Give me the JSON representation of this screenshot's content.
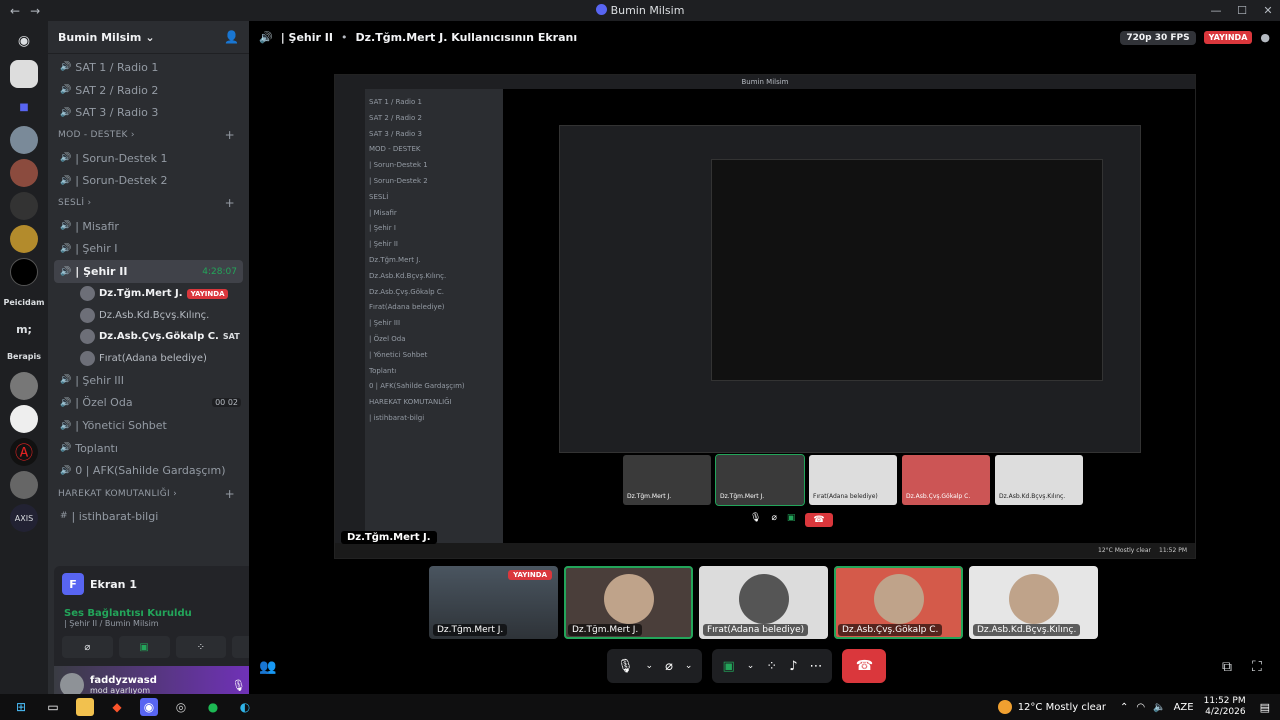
{
  "window": {
    "title": "Bumin Milsim",
    "controls": [
      "—",
      "☐",
      "✕"
    ]
  },
  "sidebar": {
    "server_name": "Bumin Milsim",
    "guild_labels": [
      "Peicidam",
      "m;",
      "Berapis"
    ],
    "channels": [
      {
        "type": "voice",
        "name": "SAT 1 / Radio 1"
      },
      {
        "type": "voice",
        "name": "SAT 2 / Radio 2"
      },
      {
        "type": "voice",
        "name": "SAT 3 / Radio 3"
      }
    ],
    "cat_mod": "MOD - DESTEK",
    "mod_channels": [
      "| Sorun-Destek 1",
      "| Sorun-Destek 2"
    ],
    "cat_sesli": "SESLİ",
    "sesli_channels": [
      "| Misafir",
      "| Şehir I"
    ],
    "active_channel": "| Şehir II",
    "active_time": "4:28:07",
    "members": [
      {
        "name": "Dz.Tğm.Mert J.",
        "badge": "YAYINDA",
        "bold": true
      },
      {
        "name": "Dz.Asb.Kd.Bçvş.Kılınç.",
        "badge": "",
        "bold": false
      },
      {
        "name": "Dz.Asb.Çvş.Gökalp C.",
        "badge": "SAT",
        "bold": true
      },
      {
        "name": "Fırat(Adana belediye)",
        "badge": "",
        "bold": false
      }
    ],
    "after_channels": [
      {
        "name": "| Şehir III",
        "pill": ""
      },
      {
        "name": "| Özel Oda",
        "pill": "00 02"
      },
      {
        "name": "| Yönetici Sohbet",
        "pill": ""
      },
      {
        "name": "Toplantı",
        "pill": ""
      },
      {
        "name": "0 | AFK(Sahilde Gardaşçım)",
        "pill": ""
      }
    ],
    "cat_harekat": "HAREKAT KOMUTANLIĞI",
    "harekat_channels": [
      "| istihbarat-bilgi"
    ]
  },
  "voice_panel": {
    "screen_label": "Ekran 1",
    "conn_title": "Ses Bağlantısı Kuruldu",
    "conn_sub": "| Şehir II / Bumin Milsim",
    "user_name": "faddyzwasd",
    "user_status": "mod ayarlıyom"
  },
  "stage": {
    "channel": "| Şehir II",
    "stream_title": "Dz.Tğm.Mert J. Kullanıcısının Ekranı",
    "quality": "720p 30 FPS",
    "live": "YAYINDA",
    "stream_label": "Dz.Tğm.Mert J."
  },
  "nested": {
    "channels": [
      "SAT 1 / Radio 1",
      "SAT 2 / Radio 2",
      "SAT 3 / Radio 3",
      "MOD - DESTEK",
      "| Sorun-Destek 1",
      "| Sorun-Destek 2",
      "SESLİ",
      "| Misafir",
      "| Şehir I",
      "| Şehir II",
      "Dz.Tğm.Mert J.",
      "Dz.Asb.Kd.Bçvş.Kılınç.",
      "Dz.Asb.Çvş.Gökalp C.",
      "Fırat(Adana belediye)",
      "| Şehir III",
      "| Özel Oda",
      "| Yönetici Sohbet",
      "Toplantı",
      "0 | AFK(Sahilde Gardaşçım)",
      "HAREKAT KOMUTANLIĞI",
      "| istihbarat-bilgi"
    ],
    "tiles": [
      "Dz.Tğm.Mert J.",
      "Dz.Tğm.Mert J.",
      "Fırat(Adana belediye)",
      "Dz.Asb.Çvş.Gökalp C.",
      "Dz.Asb.Kd.Bçvş.Kılınç."
    ],
    "weather": "12°C Mostly clear",
    "time": "11:52 PM"
  },
  "tiles": [
    {
      "label": "Dz.Tğm.Mert J.",
      "live": "YAYINDA"
    },
    {
      "label": "Dz.Tğm.Mert J.",
      "live": ""
    },
    {
      "label": "Fırat(Adana belediye)",
      "live": ""
    },
    {
      "label": "Dz.Asb.Çvş.Gökalp C.",
      "live": ""
    },
    {
      "label": "Dz.Asb.Kd.Bçvş.Kılınç.",
      "live": ""
    }
  ],
  "taskbar": {
    "weather": "12°C  Mostly clear",
    "lang": "AZE",
    "time": "11:52 PM",
    "date": "4/2/2026"
  }
}
